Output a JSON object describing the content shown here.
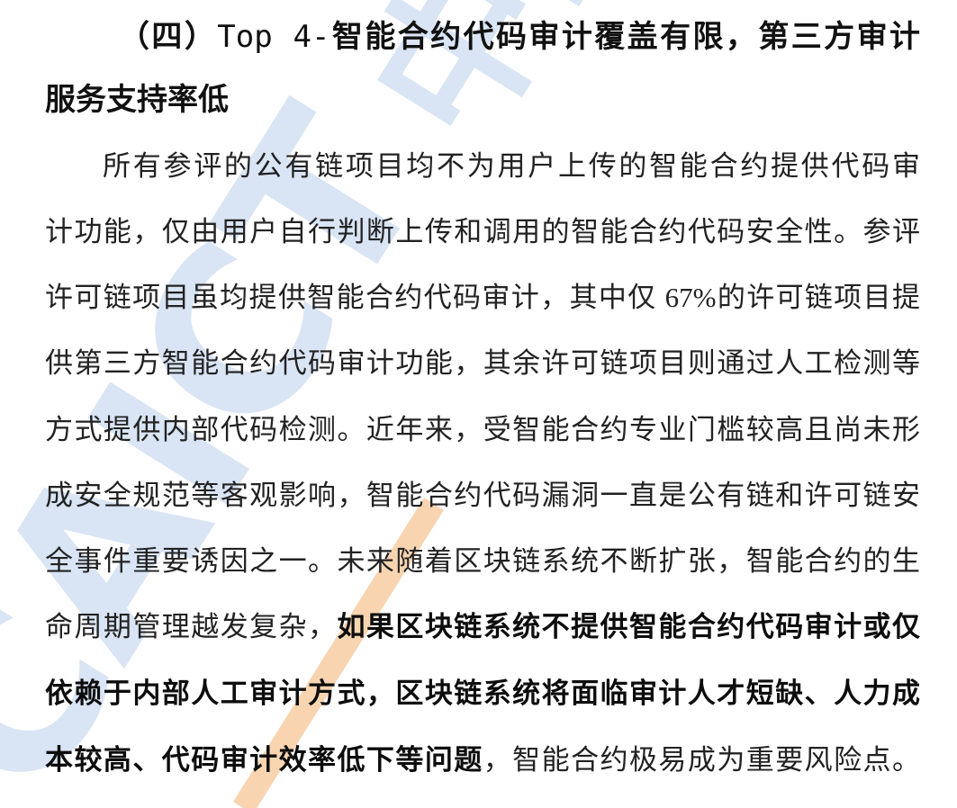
{
  "heading": {
    "prefix": "（四）",
    "mono": "Top 4-",
    "line1_rest": "智能合约代码审计覆盖有限，第三方审计",
    "line2": "服务支持率低"
  },
  "paragraph": {
    "lines": [
      {
        "segments": [
          {
            "text": "所有参评的公有链项目均不为用户上传的智能合约提供代码审"
          }
        ]
      },
      {
        "segments": [
          {
            "text": "计功能，仅由用户自行判断上传和调用的智能合约代码安全性。参评"
          }
        ]
      },
      {
        "segments": [
          {
            "text": "许可链项目虽均提供智能合约代码审计，其中仅 67%的许可链项目提"
          }
        ]
      },
      {
        "segments": [
          {
            "text": "供第三方智能合约代码审计功能，其余许可链项目则通过人工检测等"
          }
        ]
      },
      {
        "segments": [
          {
            "text": "方式提供内部代码检测。近年来，受智能合约专业门槛较高且尚未形"
          }
        ]
      },
      {
        "segments": [
          {
            "text": "成安全规范等客观影响，智能合约代码漏洞一直是公有链和许可链安"
          }
        ]
      },
      {
        "segments": [
          {
            "text": "全事件重要诱因之一。未来随着区块链系统不断扩张，智能合约的生"
          }
        ]
      },
      {
        "segments": [
          {
            "text": "命周期管理越发复杂，"
          },
          {
            "text": "如果区块链系统不提供智能合约代码审计或仅"
          }
        ]
      },
      {
        "segments": [
          {
            "text": "依赖于内部人工审计方式，区块链系统将面临审计人才短缺、人力成"
          }
        ]
      },
      {
        "segments": [
          {
            "text": "本较高、代码审计效率低下等问题"
          },
          {
            "text": "，智能合约极易成为重要风险点。"
          }
        ]
      }
    ]
  },
  "watermark": {
    "latin": "CAICT",
    "chinese": "中国信通院",
    "color_blue": "#cddbf1",
    "color_orange": "#f4b272"
  }
}
